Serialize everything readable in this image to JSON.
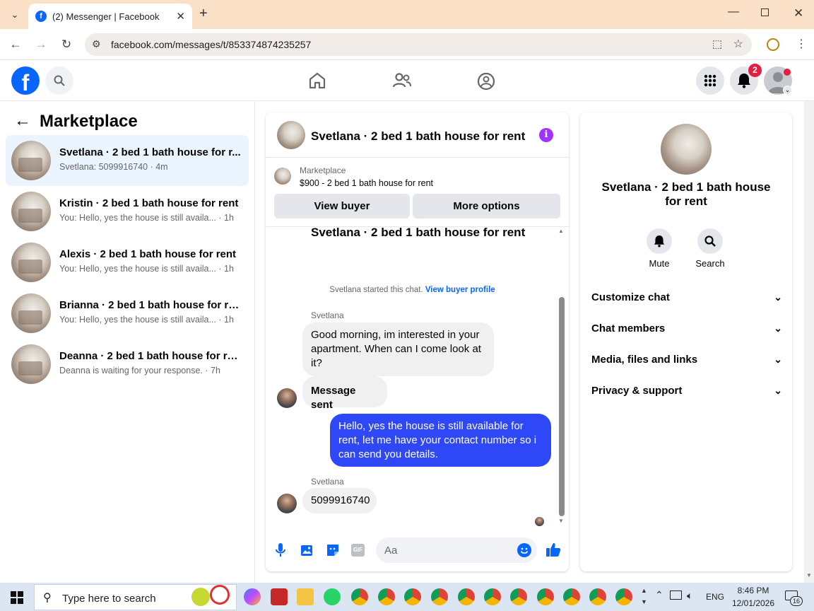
{
  "browser": {
    "tab_title": "(2) Messenger | Facebook",
    "url": "facebook.com/messages/t/853374874235257"
  },
  "header": {
    "notification_count": "2"
  },
  "sidebar": {
    "title": "Marketplace",
    "conversations": [
      {
        "title": "Svetlana · 2 bed 1 bath house for r...",
        "preview": "Svetlana: 5099916740",
        "time": "4m",
        "active": true
      },
      {
        "title": "Kristin · 2 bed 1 bath house for rent",
        "preview": "You: Hello, yes the house is still availa...",
        "time": "1h"
      },
      {
        "title": "Alexis · 2 bed 1 bath house for rent",
        "preview": "You: Hello, yes the house is still availa...",
        "time": "1h"
      },
      {
        "title": "Brianna · 2 bed 1 bath house for rent",
        "preview": "You: Hello, yes the house is still availa...",
        "time": "1h"
      },
      {
        "title": "Deanna · 2 bed 1 bath house for rent",
        "preview": "Deanna is waiting for your response.",
        "time": "7h"
      }
    ]
  },
  "chat": {
    "title": "Svetlana · 2 bed 1 bath house for rent",
    "listing_source": "Marketplace",
    "listing": "$900 - 2 bed 1 bath house for rent",
    "view_buyer": "View buyer",
    "more_options": "More options",
    "thread_title": "Svetlana · 2 bed 1 bath house for rent",
    "started": "Svetlana started this chat.",
    "buyer_profile_link": "View buyer profile",
    "messages": [
      {
        "sender": "Svetlana",
        "text": "Good morning, im interested in your apartment. When can I come look at it?"
      },
      {
        "text": "Message sent"
      },
      {
        "text": "Hello, yes the house is still available for rent, let me have your contact number so i can send you details."
      },
      {
        "sender": "Svetlana",
        "text": "5099916740"
      }
    ],
    "composer_placeholder": "Aa"
  },
  "details": {
    "name": "Svetlana · 2 bed 1 bath house for rent",
    "mute": "Mute",
    "search": "Search",
    "sections": [
      "Customize chat",
      "Chat members",
      "Media, files and links",
      "Privacy & support"
    ]
  },
  "taskbar": {
    "search_placeholder": "Type here to search",
    "language": "ENG",
    "time": "8:46 PM",
    "date": "12/01/2026",
    "notif_count": "16"
  },
  "colors": {
    "facebook_blue": "#0866ff",
    "message_out": "#2e47f7",
    "badge_red": "#e41e3f"
  }
}
